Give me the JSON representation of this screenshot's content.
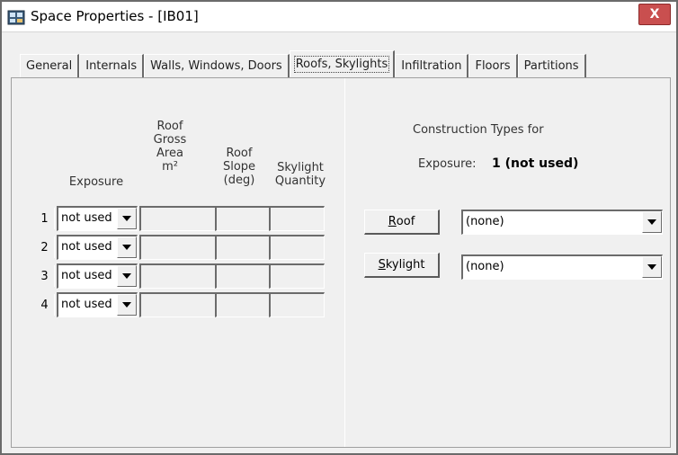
{
  "window": {
    "title": "Space Properties - [IB01]",
    "close_label": "X"
  },
  "tabs": [
    {
      "label": "General",
      "active": false
    },
    {
      "label": "Internals",
      "active": false
    },
    {
      "label": "Walls, Windows, Doors",
      "active": false
    },
    {
      "label": "Roofs, Skylights",
      "active": true
    },
    {
      "label": "Infiltration",
      "active": false
    },
    {
      "label": "Floors",
      "active": false
    },
    {
      "label": "Partitions",
      "active": false
    }
  ],
  "grid": {
    "headers": {
      "exposure": "Exposure",
      "roof_gross_area": [
        "Roof",
        "Gross",
        "Area",
        "m²"
      ],
      "roof_slope": [
        "Roof",
        "Slope",
        "(deg)"
      ],
      "skylight_quantity": [
        "Skylight",
        "Quantity"
      ]
    },
    "rows": [
      {
        "num": "1",
        "exposure": "not used",
        "area": "",
        "slope": "",
        "qty": ""
      },
      {
        "num": "2",
        "exposure": "not used",
        "area": "",
        "slope": "",
        "qty": ""
      },
      {
        "num": "3",
        "exposure": "not used",
        "area": "",
        "slope": "",
        "qty": ""
      },
      {
        "num": "4",
        "exposure": "not used",
        "area": "",
        "slope": "",
        "qty": ""
      }
    ]
  },
  "construction": {
    "title": "Construction Types for",
    "exposure_label": "Exposure:",
    "exposure_value": "1 (not used)",
    "roof_button": {
      "accel": "R",
      "rest": "oof"
    },
    "skylight_button": {
      "accel": "S",
      "rest": "kylight"
    },
    "roof_select": "(none)",
    "skylight_select": "(none)"
  },
  "colors": {
    "close": "#c94f4f",
    "face": "#f0f0f0"
  }
}
